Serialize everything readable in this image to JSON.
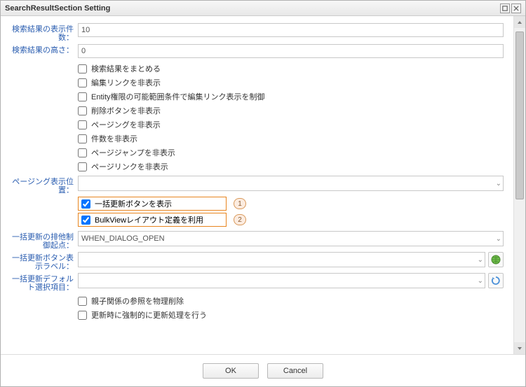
{
  "dialog": {
    "title": "SearchResultSection Setting"
  },
  "fields": {
    "display_count": {
      "label": "検索結果の表示件数：",
      "value": "10"
    },
    "height": {
      "label": "検索結果の高さ：",
      "value": "0"
    },
    "checks": {
      "summarize": "検索結果をまとめる",
      "hide_edit_link": "編集リンクを非表示",
      "entity_permission_edit": "Entity権限の可能範囲条件で編集リンク表示を制御",
      "hide_delete_btn": "削除ボタンを非表示",
      "hide_paging": "ページングを非表示",
      "hide_count": "件数を非表示",
      "hide_page_jump": "ページジャンプを非表示",
      "hide_page_link": "ページリンクを非表示"
    },
    "paging_pos": {
      "label": "ページング表示位置："
    },
    "bulk_update_btn": {
      "label": "一括更新ボタンを表示",
      "checked": true,
      "badge": "1"
    },
    "bulk_view_layout": {
      "label": "BulkViewレイアウト定義を利用",
      "checked": true,
      "badge": "2"
    },
    "bulk_exclusive": {
      "label": "一括更新の排他制御起点：",
      "value": "WHEN_DIALOG_OPEN"
    },
    "bulk_btn_label": {
      "label": "一括更新ボタン表示ラベル："
    },
    "bulk_default_item": {
      "label": "一括更新デフォルト選択項目："
    },
    "checks2": {
      "physical_delete_parent": "親子関係の参照を物理削除",
      "force_update": "更新時に強制的に更新処理を行う"
    }
  },
  "footer": {
    "ok": "OK",
    "cancel": "Cancel"
  }
}
